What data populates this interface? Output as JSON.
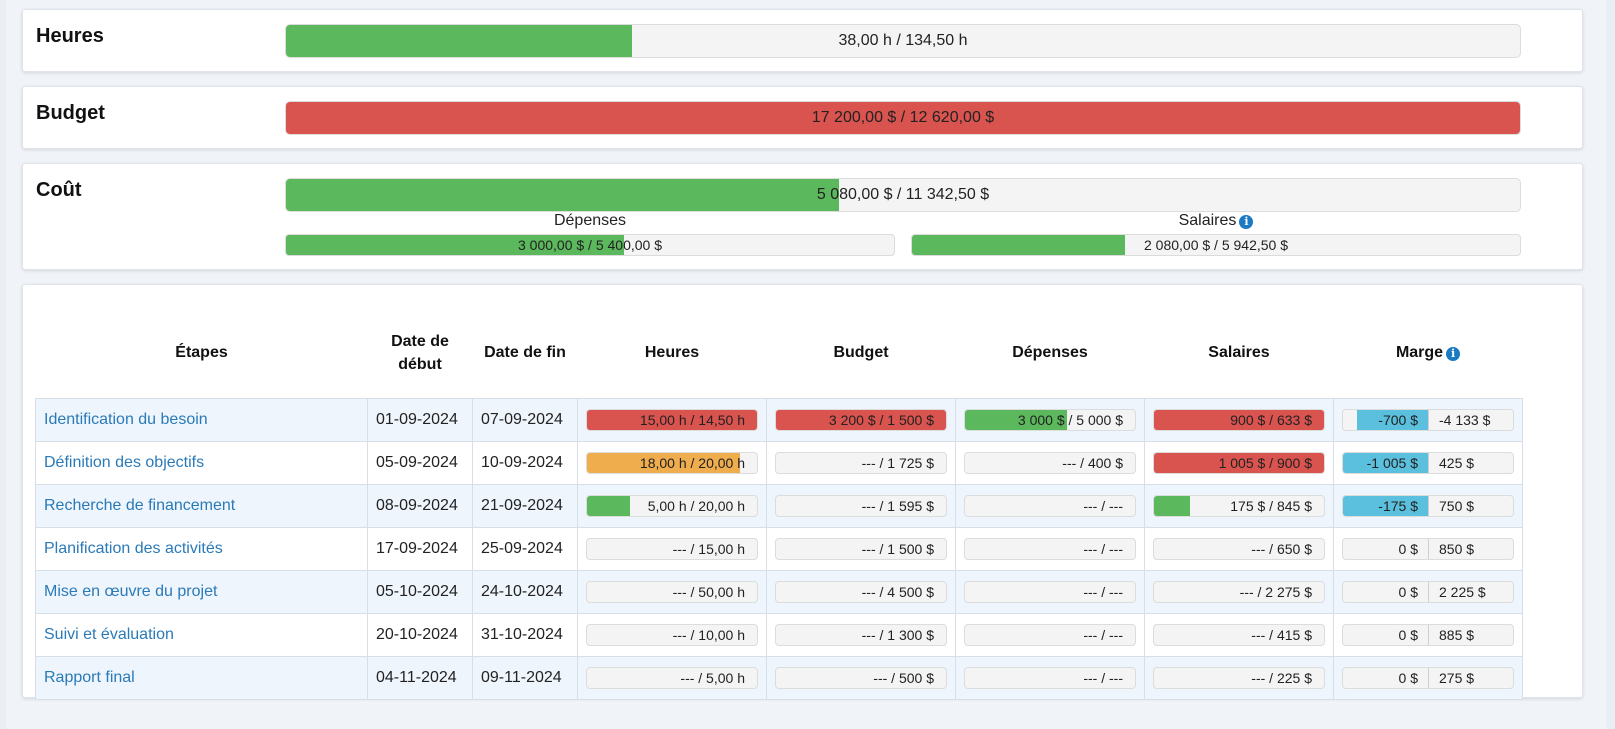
{
  "summary": {
    "heures": {
      "title": "Heures",
      "text": "38,00 h / 134,50 h",
      "fraction": 0.28,
      "color": "#5cb85c"
    },
    "budget": {
      "title": "Budget",
      "text": "17 200,00 $ / 12 620,00 $",
      "fraction": 1.0,
      "color": "#d9534f"
    },
    "cout": {
      "title": "Coût",
      "text": "5 080,00 $ / 11 342,50 $",
      "fraction": 0.448,
      "color": "#5cb85c",
      "depenses": {
        "label": "Dépenses",
        "text": "3 000,00 $ / 5 400,00 $",
        "fraction": 0.556
      },
      "salaires": {
        "label": "Salaires",
        "text": "2 080,00 $ / 5 942,50 $",
        "fraction": 0.35
      }
    }
  },
  "table": {
    "headers": {
      "etapes": "Étapes",
      "debut": "Date de début",
      "fin": "Date de fin",
      "heures": "Heures",
      "budget": "Budget",
      "depenses": "Dépenses",
      "salaires": "Salaires",
      "marge": "Marge"
    },
    "rows": [
      {
        "name": "Identification du besoin",
        "start": "01-09-2024",
        "end": "07-09-2024",
        "heures": {
          "text": "15,00 h / 14,50 h",
          "fraction": 1.0,
          "color": "red"
        },
        "budget": {
          "text": "3 200 $ / 1 500 $",
          "fraction": 1.0,
          "color": "red"
        },
        "depenses": {
          "text": "3 000 $ / 5 000 $",
          "fraction": 0.6,
          "color": "green"
        },
        "salaires": {
          "text": "900 $ / 633 $",
          "fraction": 1.0,
          "color": "red"
        },
        "marge": {
          "left": "-700 $",
          "right": "-4 133 $",
          "fraction": 0.84
        }
      },
      {
        "name": "Définition des objectifs",
        "start": "05-09-2024",
        "end": "10-09-2024",
        "heures": {
          "text": "18,00 h / 20,00 h",
          "fraction": 0.9,
          "color": "orange"
        },
        "budget": {
          "text": "--- / 1 725 $",
          "fraction": 0,
          "color": "green"
        },
        "depenses": {
          "text": "--- / 400 $",
          "fraction": 0,
          "color": "green"
        },
        "salaires": {
          "text": "1 005 $ / 900 $",
          "fraction": 1.0,
          "color": "red"
        },
        "marge": {
          "left": "-1 005 $",
          "right": "425 $",
          "fraction": 1.0
        }
      },
      {
        "name": "Recherche de financement",
        "start": "08-09-2024",
        "end": "21-09-2024",
        "heures": {
          "text": "5,00 h / 20,00 h",
          "fraction": 0.25,
          "color": "green"
        },
        "budget": {
          "text": "--- / 1 595 $",
          "fraction": 0,
          "color": "green"
        },
        "depenses": {
          "text": "--- / ---",
          "fraction": 0,
          "color": "green"
        },
        "salaires": {
          "text": "175 $ / 845 $",
          "fraction": 0.21,
          "color": "green"
        },
        "marge": {
          "left": "-175 $",
          "right": "750 $",
          "fraction": 1.0
        }
      },
      {
        "name": "Planification des activités",
        "start": "17-09-2024",
        "end": "25-09-2024",
        "heures": {
          "text": "--- / 15,00 h",
          "fraction": 0,
          "color": "green"
        },
        "budget": {
          "text": "--- / 1 500 $",
          "fraction": 0,
          "color": "green"
        },
        "depenses": {
          "text": "--- / ---",
          "fraction": 0,
          "color": "green"
        },
        "salaires": {
          "text": "--- / 650 $",
          "fraction": 0,
          "color": "green"
        },
        "marge": {
          "left": "0 $",
          "right": "850 $",
          "fraction": 0
        }
      },
      {
        "name": "Mise en œuvre du projet",
        "start": "05-10-2024",
        "end": "24-10-2024",
        "heures": {
          "text": "--- / 50,00 h",
          "fraction": 0,
          "color": "green"
        },
        "budget": {
          "text": "--- / 4 500 $",
          "fraction": 0,
          "color": "green"
        },
        "depenses": {
          "text": "--- / ---",
          "fraction": 0,
          "color": "green"
        },
        "salaires": {
          "text": "--- / 2 275 $",
          "fraction": 0,
          "color": "green"
        },
        "marge": {
          "left": "0 $",
          "right": "2 225 $",
          "fraction": 0
        }
      },
      {
        "name": "Suivi et évaluation",
        "start": "20-10-2024",
        "end": "31-10-2024",
        "heures": {
          "text": "--- / 10,00 h",
          "fraction": 0,
          "color": "green"
        },
        "budget": {
          "text": "--- / 1 300 $",
          "fraction": 0,
          "color": "green"
        },
        "depenses": {
          "text": "--- / ---",
          "fraction": 0,
          "color": "green"
        },
        "salaires": {
          "text": "--- / 415 $",
          "fraction": 0,
          "color": "green"
        },
        "marge": {
          "left": "0 $",
          "right": "885 $",
          "fraction": 0
        }
      },
      {
        "name": "Rapport final",
        "start": "04-11-2024",
        "end": "09-11-2024",
        "heures": {
          "text": "--- / 5,00 h",
          "fraction": 0,
          "color": "green"
        },
        "budget": {
          "text": "--- / 500 $",
          "fraction": 0,
          "color": "green"
        },
        "depenses": {
          "text": "--- / ---",
          "fraction": 0,
          "color": "green"
        },
        "salaires": {
          "text": "--- / 225 $",
          "fraction": 0,
          "color": "green"
        },
        "marge": {
          "left": "0 $",
          "right": "275 $",
          "fraction": 0
        }
      }
    ]
  },
  "colors": {
    "green": "#5cb85c",
    "red": "#d9534f",
    "orange": "#f0ad4e",
    "blue": "#5bc0de",
    "link": "#2a7ab8"
  },
  "icons": {
    "info": "info-circle-icon"
  }
}
